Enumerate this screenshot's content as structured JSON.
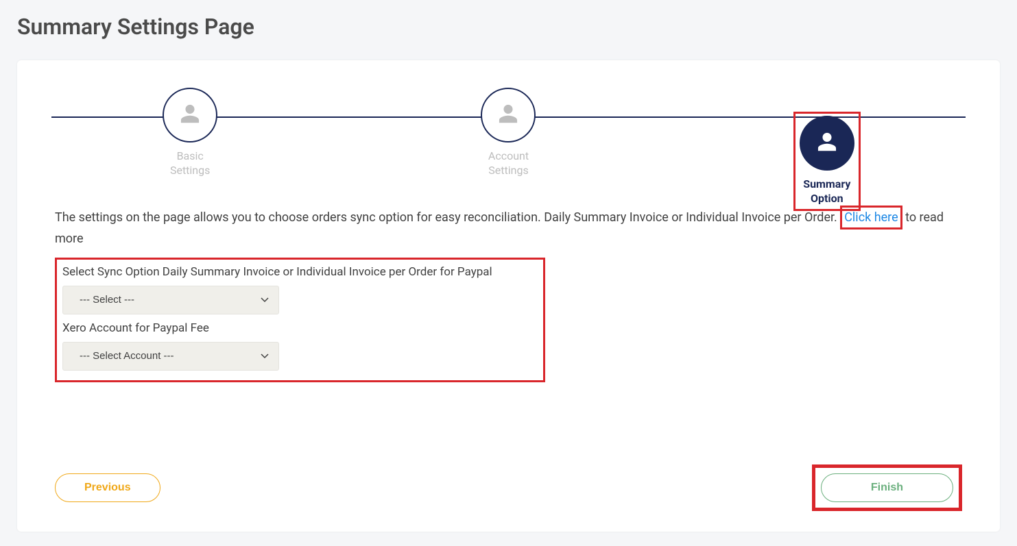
{
  "page": {
    "title": "Summary Settings Page"
  },
  "stepper": {
    "steps": [
      {
        "label": "Basic\nSettings",
        "active": false
      },
      {
        "label": "Account\nSettings",
        "active": false
      },
      {
        "label": "Summary\nOption",
        "active": true
      }
    ]
  },
  "description": {
    "text_before": "The settings on the page allows you to choose orders sync option for easy reconciliation. Daily Summary Invoice or Individual Invoice per Order. ",
    "link_text": "Click here",
    "text_after": " to read more"
  },
  "form": {
    "sync_option": {
      "label": "Select Sync Option Daily Summary Invoice or Individual Invoice per Order for Paypal",
      "placeholder": "--- Select ---"
    },
    "xero_account": {
      "label": "Xero Account for Paypal Fee",
      "placeholder": "--- Select Account ---"
    }
  },
  "buttons": {
    "previous": "Previous",
    "finish": "Finish"
  }
}
